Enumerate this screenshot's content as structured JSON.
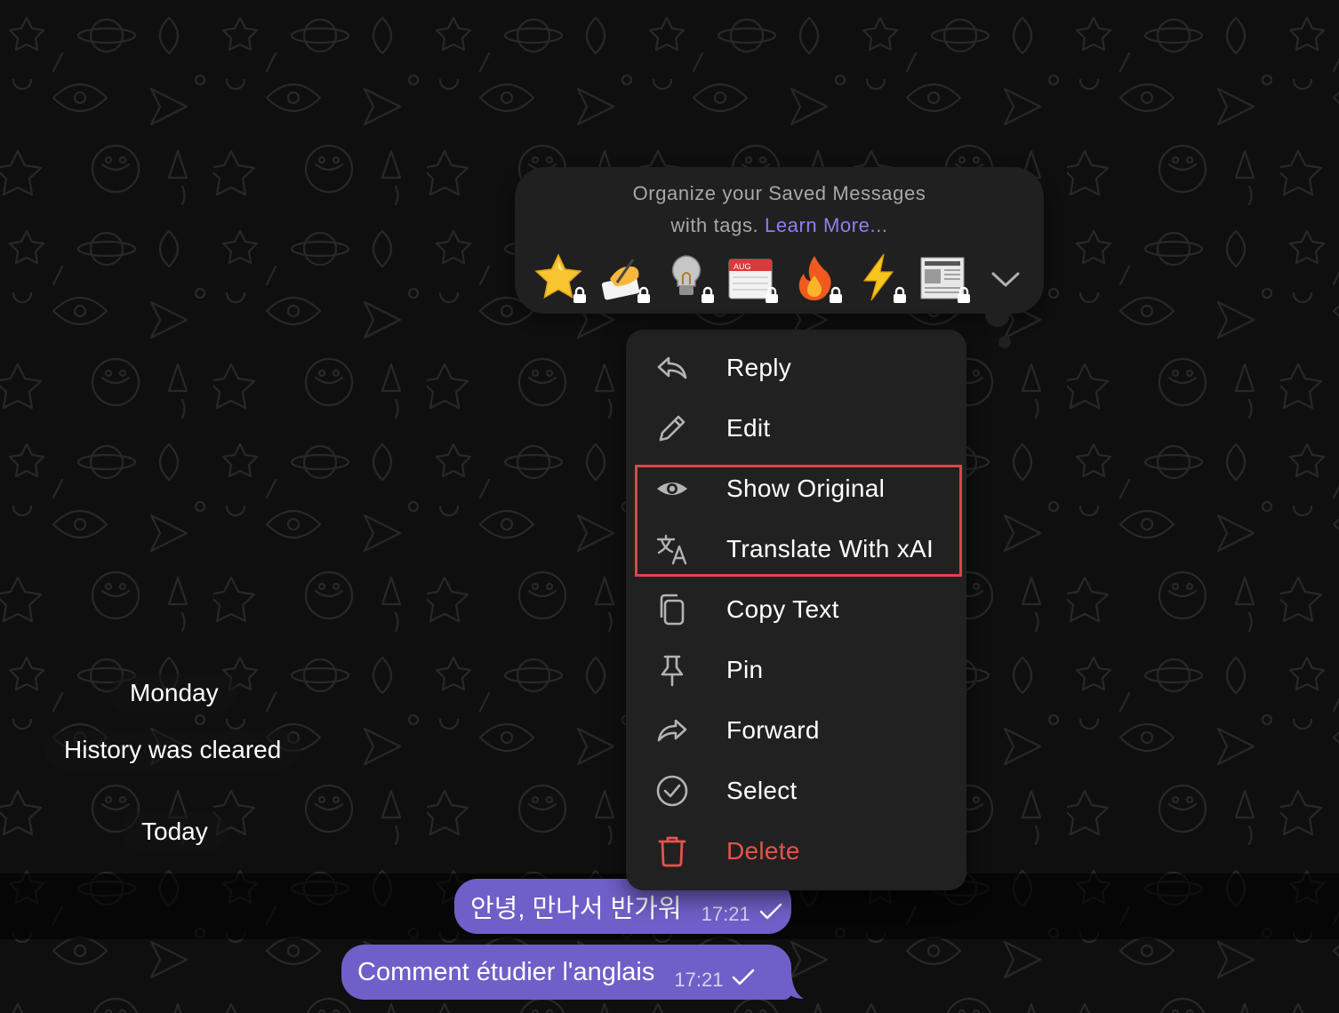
{
  "chat": {
    "date_monday": "Monday",
    "history_cleared": "History was cleared",
    "date_today": "Today",
    "messages": [
      {
        "text": "안녕, 만나서 반가워",
        "time": "17:21"
      },
      {
        "text": "Comment étudier l'anglais",
        "time": "17:21"
      }
    ]
  },
  "tag_panel": {
    "hint_line1": "Organize your Saved Messages",
    "hint_line2": "with tags.",
    "learn_more": "Learn More...",
    "tags": [
      "star-icon",
      "writing-hand-icon",
      "light-bulb-icon",
      "calendar-icon",
      "fire-icon",
      "lightning-icon",
      "newspaper-icon"
    ],
    "calendar_month": "AUG"
  },
  "context_menu": {
    "items": [
      {
        "label": "Reply",
        "icon": "reply-icon"
      },
      {
        "label": "Edit",
        "icon": "pencil-icon"
      },
      {
        "label": "Show Original",
        "icon": "eye-icon"
      },
      {
        "label": "Translate With xAI",
        "icon": "translate-icon"
      },
      {
        "label": "Copy Text",
        "icon": "copy-icon"
      },
      {
        "label": "Pin",
        "icon": "pin-icon"
      },
      {
        "label": "Forward",
        "icon": "forward-icon"
      },
      {
        "label": "Select",
        "icon": "select-check-icon"
      },
      {
        "label": "Delete",
        "icon": "trash-icon"
      }
    ]
  },
  "colors": {
    "accent": "#8f7ff0",
    "bubble": "#6f5fc8",
    "danger": "#e5534b",
    "highlight": "#e0434b",
    "menu_bg": "#212121"
  }
}
